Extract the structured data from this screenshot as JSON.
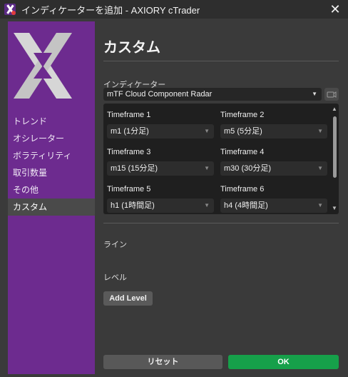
{
  "window": {
    "title": "インディケーターを追加 - AXIORY cTrader",
    "close_label": "✕"
  },
  "sidebar": {
    "items": [
      {
        "label": "トレンド"
      },
      {
        "label": "オシレーター"
      },
      {
        "label": "ボラティリティ"
      },
      {
        "label": "取引数量"
      },
      {
        "label": "その他"
      },
      {
        "label": "カスタム",
        "active": true
      }
    ]
  },
  "main": {
    "title": "カスタム",
    "indicator_label": "インディケーター",
    "indicator_value": "mTF Cloud Component Radar",
    "select_arrow": "▼",
    "timeframes": [
      {
        "label": "Timeframe 1",
        "value": "m1 (1分足)"
      },
      {
        "label": "Timeframe 2",
        "value": "m5 (5分足)"
      },
      {
        "label": "Timeframe 3",
        "value": "m15 (15分足)"
      },
      {
        "label": "Timeframe 4",
        "value": "m30 (30分足)"
      },
      {
        "label": "Timeframe 5",
        "value": "h1 (1時間足)"
      },
      {
        "label": "Timeframe 6",
        "value": "h4 (4時間足)"
      }
    ],
    "scroll_up": "▲",
    "scroll_down": "▼",
    "lines_label": "ライン",
    "levels_label": "レベル",
    "add_level_label": "Add Level"
  },
  "footer": {
    "reset_label": "リセット",
    "ok_label": "OK"
  },
  "colors": {
    "accent_purple": "#6d2b8f",
    "ok_green": "#16a04a",
    "panel_bg": "#1f1f1f",
    "window_bg": "#3a3a3a"
  },
  "icons": {
    "app": "axiory-x-icon",
    "close": "close-icon",
    "camera": "camera-icon",
    "dropdown": "chevron-down-icon"
  }
}
